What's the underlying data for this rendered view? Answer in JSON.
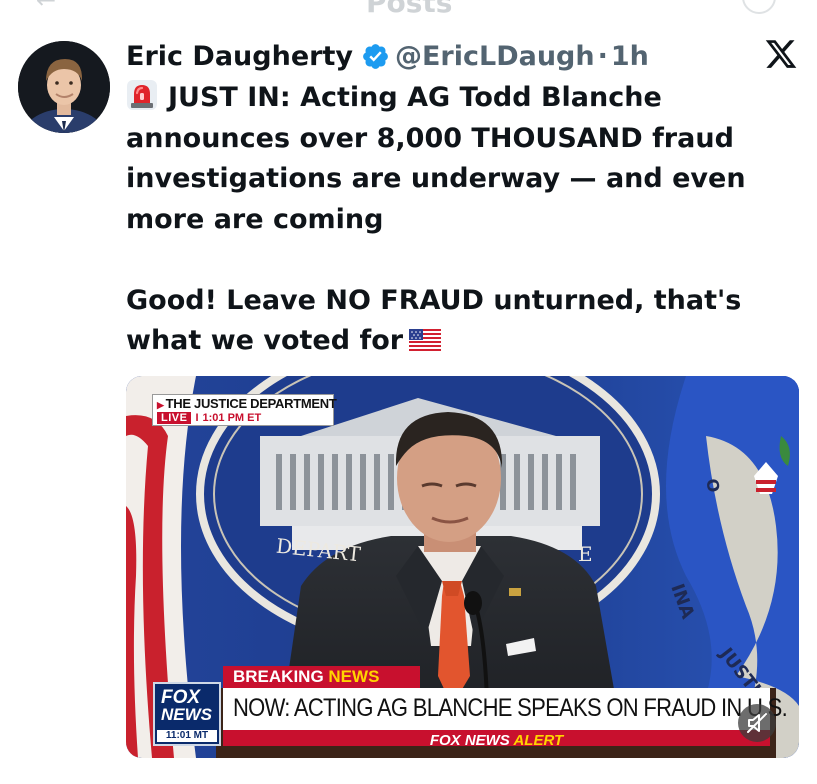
{
  "top_bar": {
    "title": "Posts"
  },
  "tweet": {
    "author": {
      "name": "Eric Daugherty",
      "handle": "@EricLDaugh",
      "separator": "·",
      "time": "1h",
      "verified": true,
      "avatar_icon": "avatar"
    },
    "close_icon": "x-logo-icon",
    "text": {
      "line_1_emoji": "siren-icon",
      "paragraph_1": "JUST IN: Acting AG Todd Blanche announces over 8,000 THOUSAND fraud investigations are underway — and even more are coming",
      "paragraph_2": "Good! Leave NO FRAUD unturned, that's what we voted for",
      "paragraph_2_emoji": "us-flag-icon"
    },
    "media": {
      "type": "video",
      "channel_box": {
        "title": "THE JUSTICE DEPARTMENT",
        "live": "LIVE",
        "separator": "I",
        "time": "1:01 PM ET"
      },
      "seal_text_left": "DEPART",
      "seal_text_right": "E",
      "flag_text_1": "INA",
      "flag_text_2": "JUSTI",
      "flag_text_3": "O",
      "breaking": {
        "word_1": "BREAKING",
        "word_2": "NEWS"
      },
      "headline": "NOW: ACTING AG BLANCHE SPEAKS ON FRAUD IN U.S.",
      "alert": {
        "word_1": "FOX NEWS",
        "word_2": "ALERT"
      },
      "logo": {
        "line_1": "FOX",
        "line_2": "NEWS",
        "clock": "11:01 MT"
      },
      "mute_icon": "mute-icon"
    }
  }
}
